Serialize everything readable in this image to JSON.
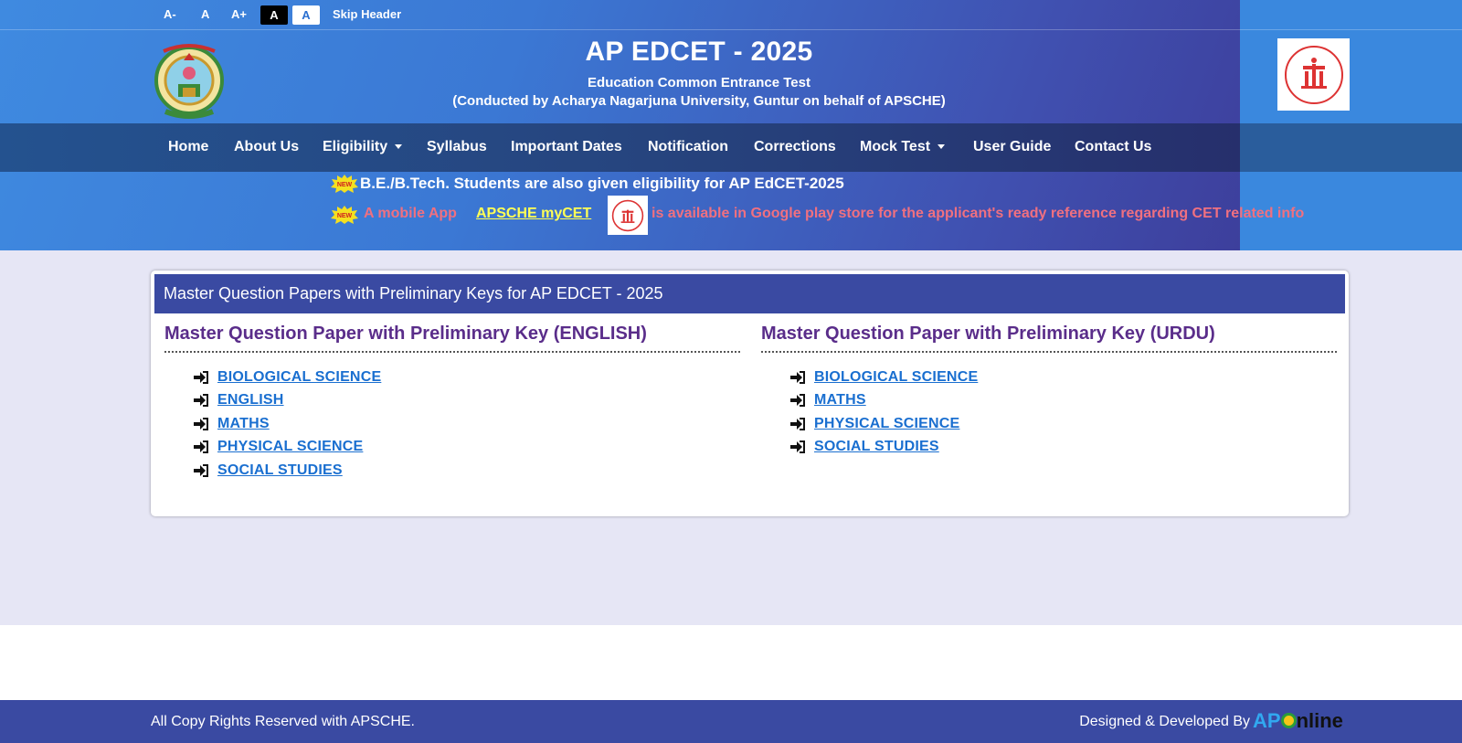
{
  "topbar": {
    "font_decrease": "A-",
    "font_normal": "A",
    "font_increase": "A+",
    "contrast_dark": "A",
    "contrast_light": "A",
    "skip_header": "Skip Header"
  },
  "header": {
    "title": "AP EDCET - 2025",
    "subtitle": "Education Common Entrance Test",
    "conducted_by": "(Conducted by Acharya Nagarjuna University, Guntur on behalf of APSCHE)",
    "left_logo_icon": "university-emblem-icon",
    "right_logo_icon": "apsche-logo-icon"
  },
  "nav": {
    "items": [
      {
        "label": "Home"
      },
      {
        "label": "About Us"
      },
      {
        "label": "Eligibility"
      },
      {
        "label": "Syllabus"
      },
      {
        "label": "Important Dates"
      },
      {
        "label": "Notification"
      },
      {
        "label": "Corrections"
      },
      {
        "label": "Mock Test"
      },
      {
        "label": "User Guide"
      },
      {
        "label": "Contact Us"
      }
    ]
  },
  "news": {
    "badge": "NEW",
    "line1": "B.E./B.Tech. Students are also given eligibility for AP EdCET-2025",
    "line2_prefix": "A mobile App",
    "line2_link": "APSCHE myCET",
    "line2_suffix": "is available in Google play store for the applicant's ready reference regarding CET related info"
  },
  "card": {
    "heading": "Master Question Papers with Preliminary Keys for AP EDCET - 2025",
    "english": {
      "title": "Master Question Paper with Preliminary Key (ENGLISH)",
      "links": [
        "BIOLOGICAL SCIENCE",
        "ENGLISH",
        "MATHS",
        "PHYSICAL SCIENCE",
        "SOCIAL STUDIES"
      ]
    },
    "urdu": {
      "title": "Master Question Paper with Preliminary Key (URDU)",
      "links": [
        "BIOLOGICAL SCIENCE",
        "MATHS",
        "PHYSICAL SCIENCE",
        "SOCIAL STUDIES"
      ]
    }
  },
  "footer": {
    "copyright": "All Copy Rights Reserved with APSCHE.",
    "designed_by": "Designed & Developed By",
    "brand_ap": "AP",
    "brand_rest": "nline"
  },
  "colors": {
    "header_blue": "#3d86dc",
    "nav_dark": "#26457f",
    "card_head": "#3a4aa2",
    "section_title": "#5a2d8a",
    "link": "#1a6fd0",
    "news_pink": "#f07080",
    "news_yellow": "#ffff55"
  }
}
